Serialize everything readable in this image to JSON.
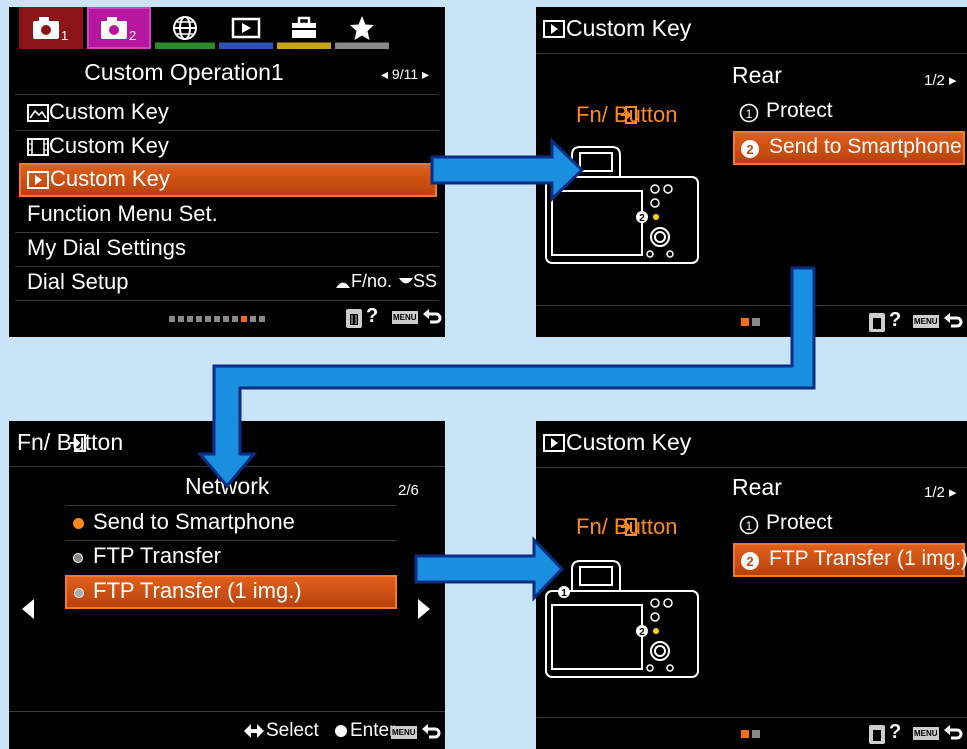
{
  "screen1": {
    "tabs": [
      {
        "icon": "camera-1-icon",
        "label": "1"
      },
      {
        "icon": "camera-2-icon",
        "label": "2"
      },
      {
        "icon": "globe-icon",
        "label": ""
      },
      {
        "icon": "playback-icon",
        "label": ""
      },
      {
        "icon": "toolbox-icon",
        "label": ""
      },
      {
        "icon": "star-icon",
        "label": ""
      }
    ],
    "title": "Custom Operation1",
    "page": "9/11",
    "items": [
      {
        "label": "Custom Key",
        "icon": "still-image-icon"
      },
      {
        "label": "Custom Key",
        "icon": "movie-icon"
      },
      {
        "label": "Custom Key",
        "icon": "playback-icon"
      },
      {
        "label": "Function Menu Set."
      },
      {
        "label": "My Dial Settings"
      },
      {
        "label": "Dial Setup",
        "value_front": "F/no.",
        "value_rear": "SS"
      }
    ],
    "footer_help": "?",
    "footer_menu": "MENU"
  },
  "screen2": {
    "title": "Custom Key",
    "subtitle": "Rear",
    "page": "1/2",
    "button_label": "Fn/ Button",
    "options": [
      {
        "num": "1",
        "label": "Protect"
      },
      {
        "num": "2",
        "label": "Send to Smartphone"
      }
    ],
    "badge": "2",
    "footer_help": "?",
    "footer_menu": "MENU"
  },
  "screen3": {
    "title": "Fn/ Button",
    "subtitle": "Network",
    "page": "2/6",
    "items": [
      {
        "label": "Send to Smartphone",
        "dot": "#ff8a1c"
      },
      {
        "label": "FTP Transfer",
        "dot": "#ffffff"
      },
      {
        "label": "FTP Transfer (1 img.)",
        "dot": "#ffffff"
      }
    ],
    "footer_select": "Select",
    "footer_enter": "Enter",
    "footer_menu": "MENU"
  },
  "screen4": {
    "title": "Custom Key",
    "subtitle": "Rear",
    "page": "1/2",
    "button_label": "Fn/ Button",
    "options": [
      {
        "num": "1",
        "label": "Protect"
      },
      {
        "num": "2",
        "label": "FTP Transfer (1 img.)"
      }
    ],
    "badge1": "1",
    "badge2": "2",
    "footer_help": "?",
    "footer_menu": "MENU"
  },
  "colors": {
    "background": "#c9e4f6",
    "highlight": "#d9561a",
    "orange_text": "#ff8a1c",
    "arrow_fill": "#1a8fe0",
    "arrow_outline": "#0b2d86"
  }
}
